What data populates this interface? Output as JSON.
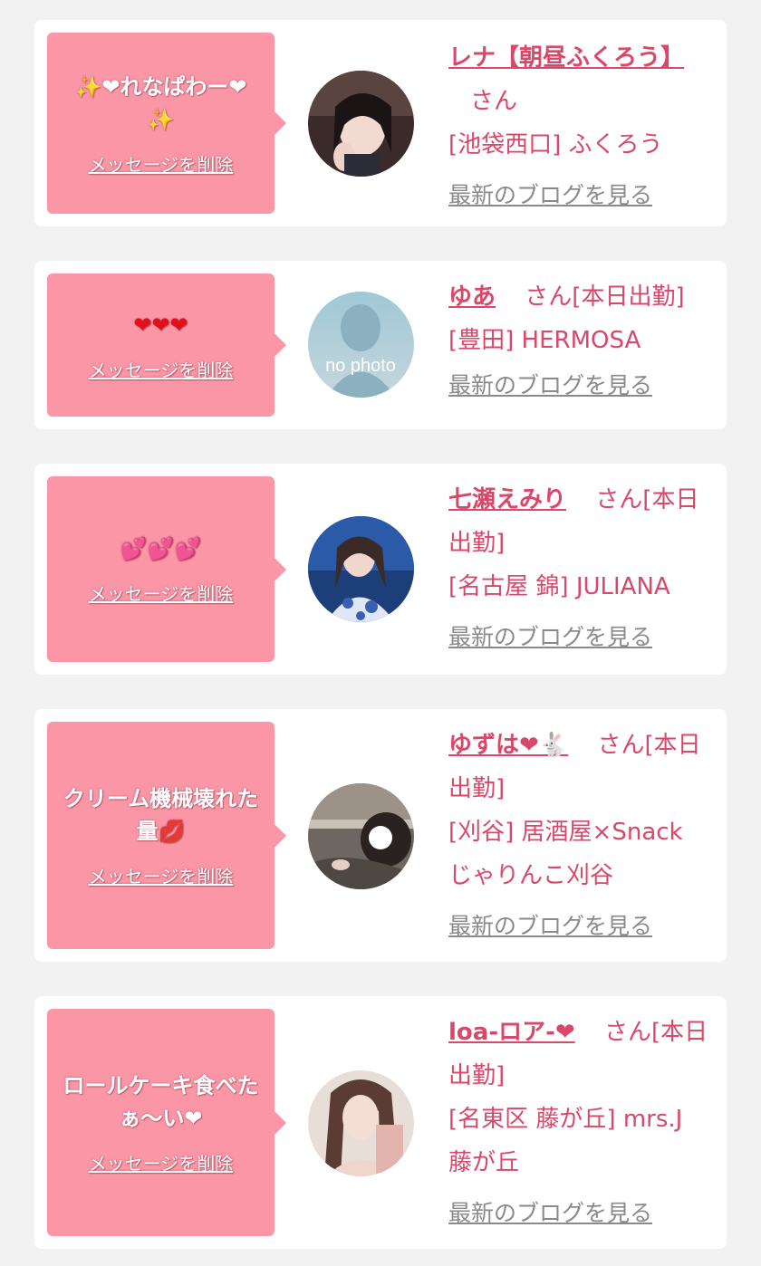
{
  "delete_label": "メッセージを削除",
  "blog_label": "最新のブログを見る",
  "entries": [
    {
      "message": "✨❤れなぱわー❤✨",
      "name": "レナ【朝昼ふくろう】",
      "honorific": "さん",
      "status": "",
      "shop_lines": [
        "[池袋西口] ふくろう"
      ]
    },
    {
      "message": "❤❤❤",
      "name": "ゆあ",
      "honorific": "さん",
      "status": "[本日出勤]",
      "avatar_text": "no photo",
      "shop_lines": [
        "[豊田] HERMOSA"
      ]
    },
    {
      "message": "💕💕💕",
      "name": "七瀬えみり",
      "honorific": "さん",
      "status": "[本日出勤]",
      "shop_lines": [
        "[名古屋 錦] JULIANA"
      ]
    },
    {
      "message": "クリーム機械壊れた量💋",
      "name": "ゆずは❤🐇",
      "honorific": "さん",
      "status": "[本日出勤]",
      "shop_lines": [
        "[刈谷] 居酒屋×Snack",
        "じゃりんこ刈谷"
      ]
    },
    {
      "message": "ロールケーキ食べたぁ〜い❤",
      "name": "loa-ロア-❤",
      "honorific": "さん",
      "status": "[本日出勤]",
      "shop_lines": [
        "[名東区 藤が丘] mrs.J",
        "藤が丘"
      ]
    }
  ],
  "colors": {
    "bubble": "#fa96a6",
    "name": "#d9476a",
    "link_gray": "#8a8a8a",
    "background": "#f2f2f2"
  }
}
